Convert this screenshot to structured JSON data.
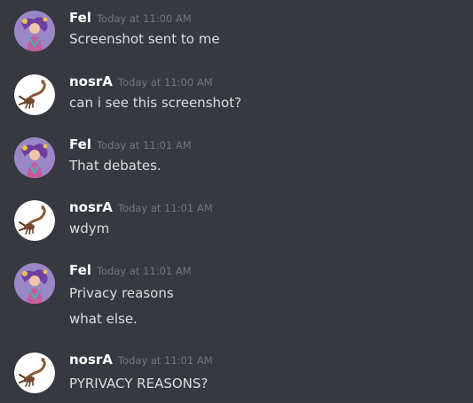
{
  "messages": [
    {
      "user": "Fel",
      "avatar_icon": "fel-avatar-icon",
      "timestamp": "Today at 11:00 AM",
      "lines": [
        "Screenshot sent to me"
      ]
    },
    {
      "user": "nosrA",
      "avatar_icon": "scorpion-avatar-icon",
      "timestamp": "Today at 11:00 AM",
      "lines": [
        "can i see this screenshot?"
      ]
    },
    {
      "user": "Fel",
      "avatar_icon": "fel-avatar-icon",
      "timestamp": "Today at 11:01 AM",
      "lines": [
        "That debates."
      ]
    },
    {
      "user": "nosrA",
      "avatar_icon": "scorpion-avatar-icon",
      "timestamp": "Today at 11:01 AM",
      "lines": [
        "wdym"
      ]
    },
    {
      "user": "Fel",
      "avatar_icon": "fel-avatar-icon",
      "timestamp": "Today at 11:01 AM",
      "lines": [
        "Privacy reasons",
        "what else."
      ]
    },
    {
      "user": "nosrA",
      "avatar_icon": "scorpion-avatar-icon",
      "timestamp": "Today at 11:01 AM",
      "lines": [
        "PYRIVACY REASONS?"
      ]
    }
  ],
  "colors": {
    "background": "#36393f",
    "username": "#ffffff",
    "timestamp": "#72767d",
    "text": "#dcddde"
  }
}
